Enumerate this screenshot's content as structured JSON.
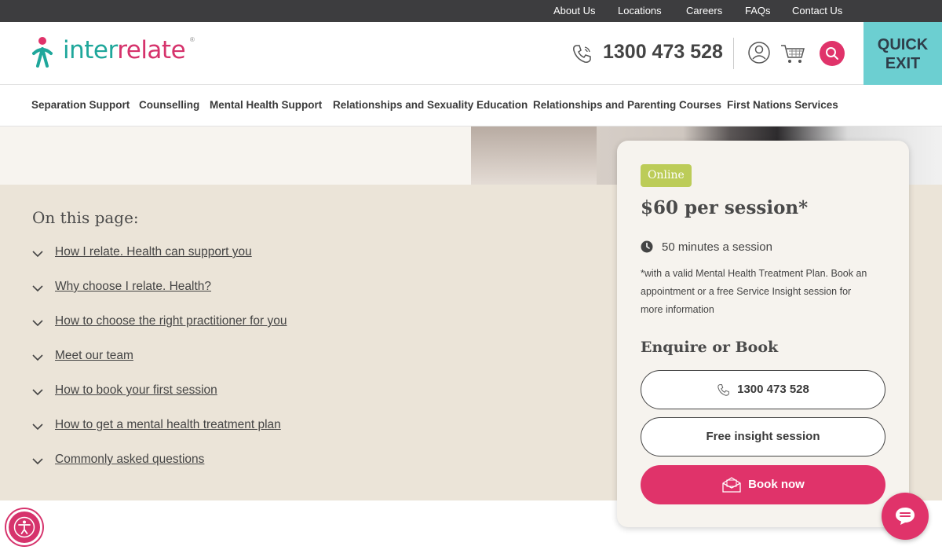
{
  "utility_nav": [
    "About Us",
    "Locations",
    "Careers",
    "FAQs",
    "Contact Us"
  ],
  "header": {
    "logo_text_1": "inter",
    "logo_text_2": "relate",
    "logo_reg": "®",
    "phone": "1300 473 528",
    "quick_exit": "QUICK EXIT"
  },
  "main_nav": [
    "Separation Support",
    "Counselling",
    "Mental Health Support",
    "Relationships and Sexuality Education",
    "Relationships and Parenting Courses",
    "First Nations Services"
  ],
  "on_this_page": {
    "title": "On this page:",
    "items": [
      "How I relate. Health can support you",
      "Why choose I relate. Health?",
      "How to choose the right practitioner for you",
      "Meet our team",
      "How to book your first session",
      "How to get a mental health treatment plan",
      "Commonly asked questions"
    ]
  },
  "card": {
    "badge": "Online",
    "price": "$60 per session*",
    "duration": "50 minutes a session",
    "note": "*with a valid Mental Health Treatment Plan. Book an appointment or a free Service Insight session for more information",
    "enquire_title": "Enquire or Book",
    "phone_button": "1300 473 528",
    "insight_button": "Free insight session",
    "book_button": "Book now"
  },
  "colors": {
    "brand_pink": "#e0336a",
    "brand_teal": "#1fa79b",
    "quick_exit_bg": "#6ccfd1",
    "section_bg": "#ebe4d8",
    "badge_green": "#bccc58"
  },
  "icons": [
    "phone-icon",
    "user-icon",
    "cart-icon",
    "search-icon",
    "chevron-down-icon",
    "clock-icon",
    "envelope-icon",
    "chat-icon",
    "accessibility-icon"
  ]
}
